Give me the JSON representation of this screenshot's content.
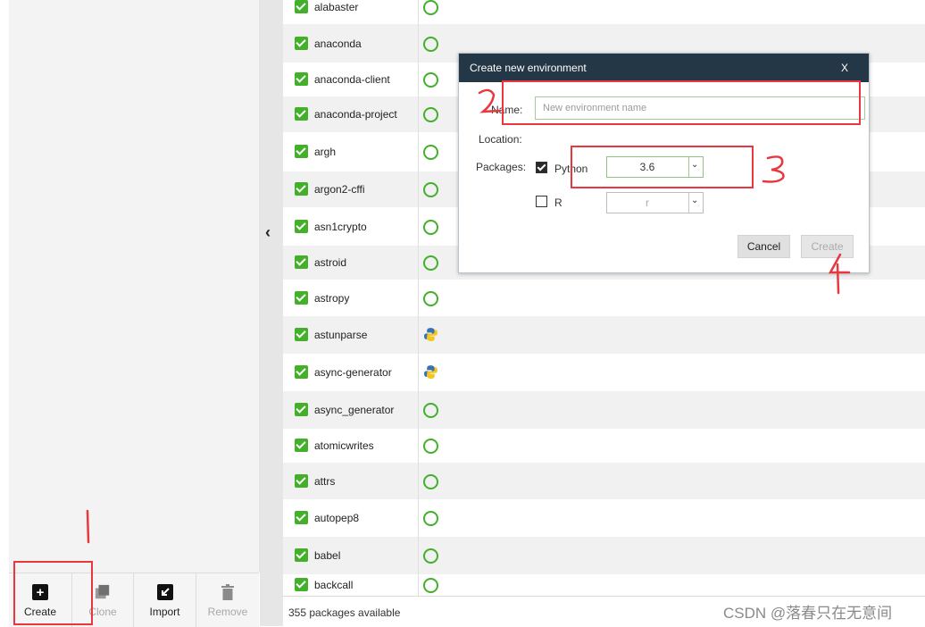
{
  "toolbar": {
    "create_label": "Create",
    "clone_label": "Clone",
    "import_label": "Import",
    "remove_label": "Remove"
  },
  "packages": {
    "rows": [
      {
        "name": "alabaster",
        "status": "circle"
      },
      {
        "name": "anaconda",
        "status": "circle"
      },
      {
        "name": "anaconda-client",
        "status": "circle"
      },
      {
        "name": "anaconda-project",
        "status": "circle"
      },
      {
        "name": "argh",
        "status": "circle"
      },
      {
        "name": "argon2-cffi",
        "status": "circle"
      },
      {
        "name": "asn1crypto",
        "status": "circle"
      },
      {
        "name": "astroid",
        "status": "circle"
      },
      {
        "name": "astropy",
        "status": "circle"
      },
      {
        "name": "astunparse",
        "status": "python"
      },
      {
        "name": "async-generator",
        "status": "python"
      },
      {
        "name": "async_generator",
        "status": "circle"
      },
      {
        "name": "atomicwrites",
        "status": "circle"
      },
      {
        "name": "attrs",
        "status": "circle"
      },
      {
        "name": "autopep8",
        "status": "circle"
      },
      {
        "name": "babel",
        "status": "circle"
      },
      {
        "name": "backcall",
        "status": "circle"
      }
    ],
    "count_text": "355 packages available"
  },
  "dialog": {
    "title": "Create new environment",
    "close_label": "X",
    "name_label": "Name:",
    "name_placeholder": "New environment name",
    "location_label": "Location:",
    "packages_label": "Packages:",
    "python_label": "Python",
    "python_checked": true,
    "python_version": "3.6",
    "r_label": "R",
    "r_checked": false,
    "r_value": "r",
    "cancel_label": "Cancel",
    "create_label": "Create"
  },
  "watermark": "CSDN @落春只在无意间",
  "colors": {
    "check_green": "#43b02a",
    "dialog_header": "#243746",
    "annotation_red": "#e8373e"
  }
}
